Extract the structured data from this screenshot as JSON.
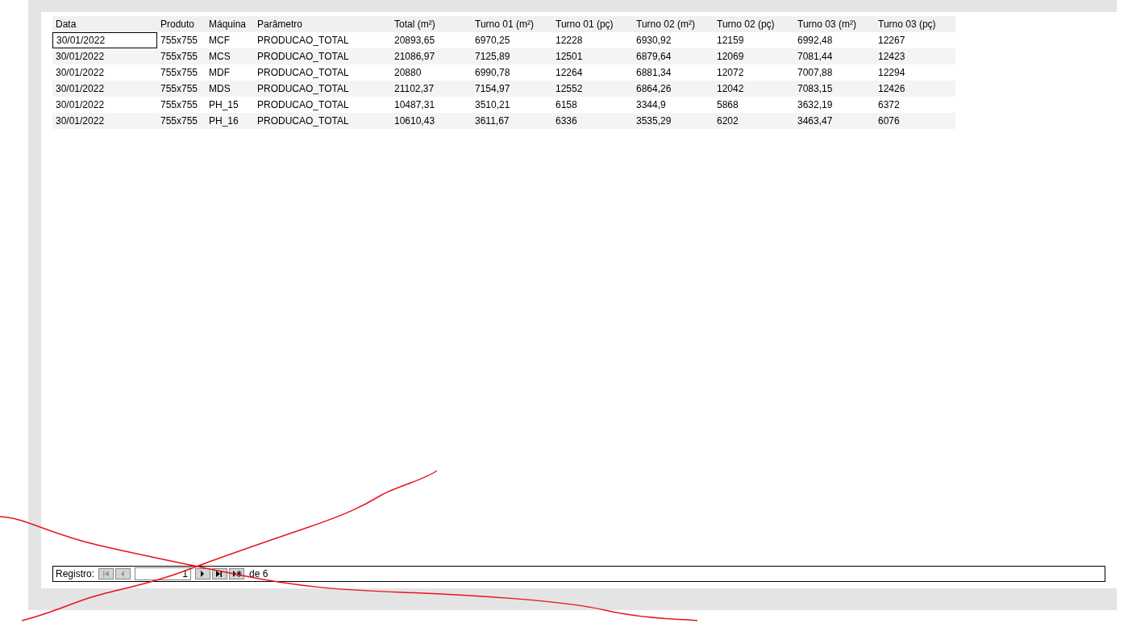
{
  "table": {
    "columns": [
      "Data",
      "Produto",
      "Máquina",
      "Parâmetro",
      "Total (m²)",
      "Turno 01 (m²)",
      "Turno 01 (pç)",
      "Turno 02 (m²)",
      "Turno 02 (pç)",
      "Turno 03 (m²)",
      "Turno 03 (pç)"
    ],
    "rows": [
      {
        "selected": true,
        "cells": [
          "30/01/2022",
          "755x755",
          "MCF",
          "PRODUCAO_TOTAL",
          "20893,65",
          "6970,25",
          "12228",
          "6930,92",
          "12159",
          "6992,48",
          "12267"
        ]
      },
      {
        "selected": false,
        "cells": [
          "30/01/2022",
          "755x755",
          "MCS",
          "PRODUCAO_TOTAL",
          "21086,97",
          "7125,89",
          "12501",
          "6879,64",
          "12069",
          "7081,44",
          "12423"
        ]
      },
      {
        "selected": false,
        "cells": [
          "30/01/2022",
          "755x755",
          "MDF",
          "PRODUCAO_TOTAL",
          "20880",
          "6990,78",
          "12264",
          "6881,34",
          "12072",
          "7007,88",
          "12294"
        ]
      },
      {
        "selected": false,
        "cells": [
          "30/01/2022",
          "755x755",
          "MDS",
          "PRODUCAO_TOTAL",
          "21102,37",
          "7154,97",
          "12552",
          "6864,26",
          "12042",
          "7083,15",
          "12426"
        ]
      },
      {
        "selected": false,
        "cells": [
          "30/01/2022",
          "755x755",
          "PH_15",
          "PRODUCAO_TOTAL",
          "10487,31",
          "3510,21",
          "6158",
          "3344,9",
          "5868",
          "3632,19",
          "6372"
        ]
      },
      {
        "selected": false,
        "cells": [
          "30/01/2022",
          "755x755",
          "PH_16",
          "PRODUCAO_TOTAL",
          "10610,43",
          "3611,67",
          "6336",
          "3535,29",
          "6202",
          "3463,47",
          "6076"
        ]
      }
    ]
  },
  "navigator": {
    "label": "Registro:",
    "first_disabled": true,
    "prev_disabled": true,
    "next_disabled": false,
    "last_disabled": false,
    "new_disabled": false,
    "current": "1",
    "total": "de 6"
  }
}
